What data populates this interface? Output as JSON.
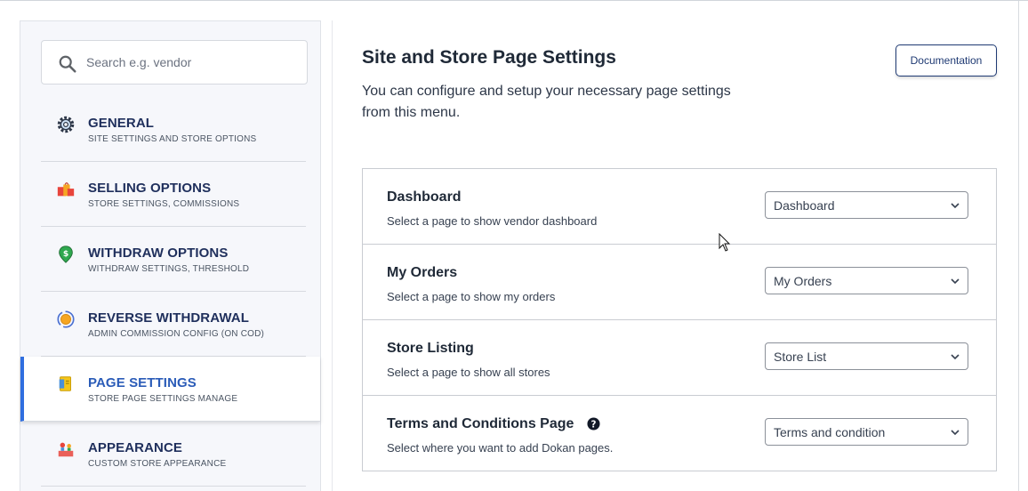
{
  "search": {
    "placeholder": "Search e.g. vendor"
  },
  "sidebar": {
    "items": [
      {
        "title": "GENERAL",
        "subtitle": "SITE SETTINGS AND STORE OPTIONS",
        "icon": "gear-icon"
      },
      {
        "title": "SELLING OPTIONS",
        "subtitle": "STORE SETTINGS, COMMISSIONS",
        "icon": "shopping-bags-icon"
      },
      {
        "title": "WITHDRAW OPTIONS",
        "subtitle": "WITHDRAW SETTINGS, THRESHOLD",
        "icon": "money-pin-icon"
      },
      {
        "title": "REVERSE WITHDRAWAL",
        "subtitle": "ADMIN COMMISSION CONFIG (ON COD)",
        "icon": "coin-cycle-icon"
      },
      {
        "title": "PAGE SETTINGS",
        "subtitle": "STORE PAGE SETTINGS MANAGE",
        "icon": "page-icon",
        "active": true
      },
      {
        "title": "APPEARANCE",
        "subtitle": "CUSTOM STORE APPEARANCE",
        "icon": "appearance-icon"
      }
    ]
  },
  "main": {
    "title": "Site and Store Page Settings",
    "description": "You can configure and setup your necessary page settings from this menu.",
    "documentation_label": "Documentation",
    "rows": [
      {
        "title": "Dashboard",
        "subtitle": "Select a page to show vendor dashboard",
        "value": "Dashboard"
      },
      {
        "title": "My Orders",
        "subtitle": "Select a page to show my orders",
        "value": "My Orders"
      },
      {
        "title": "Store Listing",
        "subtitle": "Select a page to show all stores",
        "value": "Store List"
      },
      {
        "title": "Terms and Conditions Page",
        "subtitle": "Select where you want to add Dokan pages.",
        "value": "Terms and condition",
        "help_icon": "question-circle-icon"
      }
    ]
  },
  "colors": {
    "accent": "#2f6ee0",
    "menu_title": "#1f2f5c",
    "active_title": "#2b5cb8",
    "doc_button": "#1f3a73"
  }
}
